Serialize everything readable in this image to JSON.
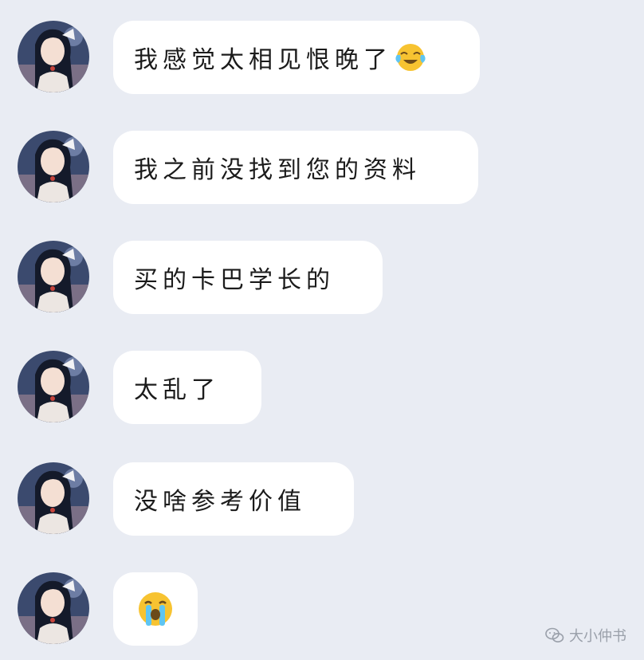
{
  "messages": [
    {
      "text": "我感觉太相见恨晚了",
      "emoji": "laugh-crying-icon"
    },
    {
      "text": "我之前没找到您的资料",
      "emoji": null
    },
    {
      "text": "买的卡巴学长的",
      "emoji": null
    },
    {
      "text": "太乱了",
      "emoji": null
    },
    {
      "text": "没啥参考价值",
      "emoji": null
    },
    {
      "text": "",
      "emoji": "loud-crying-icon"
    }
  ],
  "watermark": {
    "text": "大小仲书",
    "icon": "wechat-icon"
  },
  "colors": {
    "background": "#e9ecf3",
    "bubble": "#ffffff",
    "text": "#1b1b1b"
  }
}
